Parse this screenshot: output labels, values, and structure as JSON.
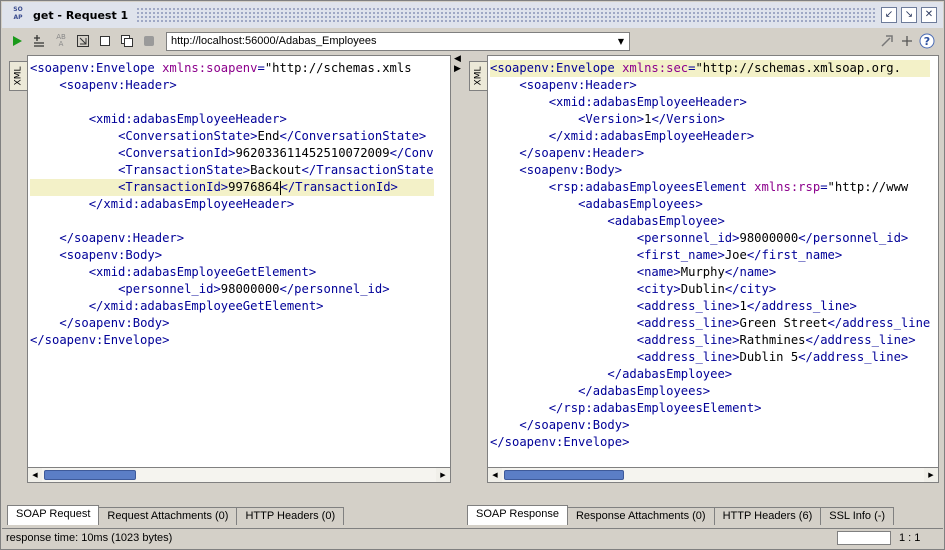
{
  "window": {
    "title": "get - Request 1",
    "logo_text": "SO AP"
  },
  "toolbar": {
    "url": "http://localhost:56000/Adabas_Employees",
    "icons": [
      "run-icon",
      "add-assertion-icon",
      "add-security-icon",
      "fit-icon",
      "single-tab-icon",
      "split-tab-icon",
      "stop-icon"
    ]
  },
  "request": {
    "side_tab": "XML",
    "lines": [
      {
        "indent": 0,
        "parts": [
          [
            "tag",
            "<soapenv:Envelope "
          ],
          [
            "attr",
            "xmlns:soapenv"
          ],
          [
            "tag",
            "="
          ],
          [
            "str",
            "\"http://schemas.xmls"
          ]
        ]
      },
      {
        "indent": 1,
        "parts": [
          [
            "tag",
            "<soapenv:Header>"
          ]
        ]
      },
      {
        "indent": 0,
        "parts": []
      },
      {
        "indent": 2,
        "parts": [
          [
            "tag",
            "<xmid:adabasEmployeeHeader>"
          ]
        ]
      },
      {
        "indent": 3,
        "parts": [
          [
            "tag",
            "<ConversationState>"
          ],
          [
            "txt",
            "End"
          ],
          [
            "tag",
            "</ConversationState>"
          ]
        ]
      },
      {
        "indent": 3,
        "parts": [
          [
            "tag",
            "<ConversationId>"
          ],
          [
            "txt",
            "962033611452510072009"
          ],
          [
            "tag",
            "</Conv"
          ]
        ]
      },
      {
        "indent": 3,
        "parts": [
          [
            "tag",
            "<TransactionState>"
          ],
          [
            "txt",
            "Backout"
          ],
          [
            "tag",
            "</TransactionState"
          ]
        ]
      },
      {
        "indent": 3,
        "hl": true,
        "parts": [
          [
            "tag",
            "<TransactionId>"
          ],
          [
            "txt",
            "9976864"
          ],
          [
            "caret",
            ""
          ],
          [
            "tag",
            "</TransactionId>"
          ]
        ]
      },
      {
        "indent": 2,
        "parts": [
          [
            "tag",
            "</xmid:adabasEmployeeHeader>"
          ]
        ]
      },
      {
        "indent": 0,
        "parts": []
      },
      {
        "indent": 1,
        "parts": [
          [
            "tag",
            "</soapenv:Header>"
          ]
        ]
      },
      {
        "indent": 1,
        "parts": [
          [
            "tag",
            "<soapenv:Body>"
          ]
        ]
      },
      {
        "indent": 2,
        "parts": [
          [
            "tag",
            "<xmid:adabasEmployeeGetElement>"
          ]
        ]
      },
      {
        "indent": 3,
        "parts": [
          [
            "tag",
            "<personnel_id>"
          ],
          [
            "txt",
            "98000000"
          ],
          [
            "tag",
            "</personnel_id>"
          ]
        ]
      },
      {
        "indent": 2,
        "parts": [
          [
            "tag",
            "</xmid:adabasEmployeeGetElement>"
          ]
        ]
      },
      {
        "indent": 1,
        "parts": [
          [
            "tag",
            "</soapenv:Body>"
          ]
        ]
      },
      {
        "indent": 0,
        "parts": [
          [
            "tag",
            "</soapenv:Envelope>"
          ]
        ]
      }
    ],
    "tabs": [
      {
        "label": "SOAP Request",
        "active": true
      },
      {
        "label": "Request Attachments (0)",
        "active": false
      },
      {
        "label": "HTTP Headers (0)",
        "active": false
      }
    ]
  },
  "response": {
    "side_tab": "XML",
    "lines": [
      {
        "indent": 0,
        "hl": true,
        "parts": [
          [
            "tag",
            "<soapenv:Envelope "
          ],
          [
            "attr",
            "xmlns:sec"
          ],
          [
            "tag",
            "="
          ],
          [
            "str",
            "\"http://schemas.xmlsoap.org."
          ]
        ]
      },
      {
        "indent": 1,
        "parts": [
          [
            "tag",
            "<soapenv:Header>"
          ]
        ]
      },
      {
        "indent": 2,
        "parts": [
          [
            "tag",
            "<xmid:adabasEmployeeHeader>"
          ]
        ]
      },
      {
        "indent": 3,
        "parts": [
          [
            "tag",
            "<Version>"
          ],
          [
            "txt",
            "1"
          ],
          [
            "tag",
            "</Version>"
          ]
        ]
      },
      {
        "indent": 2,
        "parts": [
          [
            "tag",
            "</xmid:adabasEmployeeHeader>"
          ]
        ]
      },
      {
        "indent": 1,
        "parts": [
          [
            "tag",
            "</soapenv:Header>"
          ]
        ]
      },
      {
        "indent": 1,
        "parts": [
          [
            "tag",
            "<soapenv:Body>"
          ]
        ]
      },
      {
        "indent": 2,
        "parts": [
          [
            "tag",
            "<rsp:adabasEmployeesElement "
          ],
          [
            "attr",
            "xmlns:rsp"
          ],
          [
            "tag",
            "="
          ],
          [
            "str",
            "\"http://www"
          ]
        ]
      },
      {
        "indent": 3,
        "parts": [
          [
            "tag",
            "<adabasEmployees>"
          ]
        ]
      },
      {
        "indent": 4,
        "parts": [
          [
            "tag",
            "<adabasEmployee>"
          ]
        ]
      },
      {
        "indent": 5,
        "parts": [
          [
            "tag",
            "<personnel_id>"
          ],
          [
            "txt",
            "98000000"
          ],
          [
            "tag",
            "</personnel_id>"
          ]
        ]
      },
      {
        "indent": 5,
        "parts": [
          [
            "tag",
            "<first_name>"
          ],
          [
            "txt",
            "Joe"
          ],
          [
            "tag",
            "</first_name>"
          ]
        ]
      },
      {
        "indent": 5,
        "parts": [
          [
            "tag",
            "<name>"
          ],
          [
            "txt",
            "Murphy"
          ],
          [
            "tag",
            "</name>"
          ]
        ]
      },
      {
        "indent": 5,
        "parts": [
          [
            "tag",
            "<city>"
          ],
          [
            "txt",
            "Dublin"
          ],
          [
            "tag",
            "</city>"
          ]
        ]
      },
      {
        "indent": 5,
        "parts": [
          [
            "tag",
            "<address_line>"
          ],
          [
            "txt",
            "1"
          ],
          [
            "tag",
            "</address_line>"
          ]
        ]
      },
      {
        "indent": 5,
        "parts": [
          [
            "tag",
            "<address_line>"
          ],
          [
            "txt",
            "Green Street"
          ],
          [
            "tag",
            "</address_line"
          ]
        ]
      },
      {
        "indent": 5,
        "parts": [
          [
            "tag",
            "<address_line>"
          ],
          [
            "txt",
            "Rathmines"
          ],
          [
            "tag",
            "</address_line>"
          ]
        ]
      },
      {
        "indent": 5,
        "parts": [
          [
            "tag",
            "<address_line>"
          ],
          [
            "txt",
            "Dublin 5"
          ],
          [
            "tag",
            "</address_line>"
          ]
        ]
      },
      {
        "indent": 4,
        "parts": [
          [
            "tag",
            "</adabasEmployee>"
          ]
        ]
      },
      {
        "indent": 3,
        "parts": [
          [
            "tag",
            "</adabasEmployees>"
          ]
        ]
      },
      {
        "indent": 2,
        "parts": [
          [
            "tag",
            "</rsp:adabasEmployeesElement>"
          ]
        ]
      },
      {
        "indent": 1,
        "parts": [
          [
            "tag",
            "</soapenv:Body>"
          ]
        ]
      },
      {
        "indent": 0,
        "parts": [
          [
            "tag",
            "</soapenv:Envelope>"
          ]
        ]
      }
    ],
    "tabs": [
      {
        "label": "SOAP Response",
        "active": true
      },
      {
        "label": "Response Attachments (0)",
        "active": false
      },
      {
        "label": "HTTP Headers (6)",
        "active": false
      },
      {
        "label": "SSL Info (-)",
        "active": false
      }
    ]
  },
  "status": {
    "text": "response time: 10ms (1023 bytes)",
    "position": "1 : 1"
  }
}
